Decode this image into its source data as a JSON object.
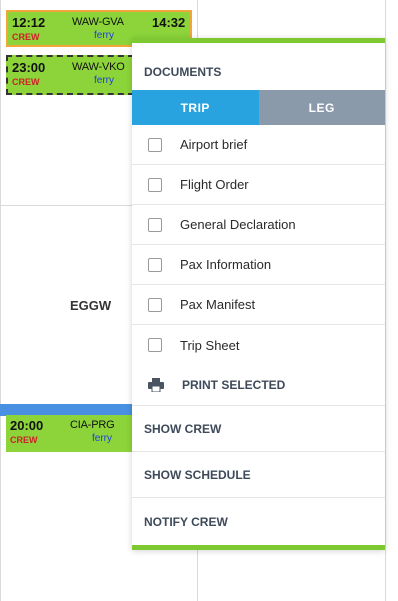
{
  "schedule": {
    "airport": "EGGW",
    "flights": [
      {
        "dep_time": "12:12",
        "route": "WAW-GVA",
        "arr_time": "14:32",
        "crew_label": "CREW",
        "note": "ferry"
      },
      {
        "dep_time": "23:00",
        "route": "WAW-VKO",
        "crew_label": "CREW",
        "note": "ferry"
      },
      {
        "dep_time": "20:00",
        "route": "CIA-PRG",
        "crew_label": "CREW",
        "note": "ferry"
      }
    ]
  },
  "menu": {
    "heading": "DOCUMENTS",
    "tabs": [
      {
        "label": "TRIP",
        "active": true
      },
      {
        "label": "LEG",
        "active": false
      }
    ],
    "documents": [
      {
        "label": "Airport brief",
        "checked": false
      },
      {
        "label": "Flight Order",
        "checked": false
      },
      {
        "label": "General Declaration",
        "checked": false
      },
      {
        "label": "Pax Information",
        "checked": false
      },
      {
        "label": "Pax Manifest",
        "checked": false
      },
      {
        "label": "Trip Sheet",
        "checked": false
      }
    ],
    "print_label": "PRINT SELECTED",
    "actions": {
      "show_crew": "SHOW CREW",
      "show_schedule": "SHOW SCHEDULE",
      "notify_crew": "NOTIFY CREW"
    }
  },
  "colors": {
    "flight_green": "#8cd43a",
    "menu_accent": "#7ec832",
    "tab_active": "#29a3e0",
    "tab_inactive": "#8a9aaa",
    "crew_red": "#d0202a",
    "ferry_blue": "#1e3fe0"
  },
  "icons": {
    "print": "printer-icon",
    "checkbox": "checkbox-icon"
  }
}
